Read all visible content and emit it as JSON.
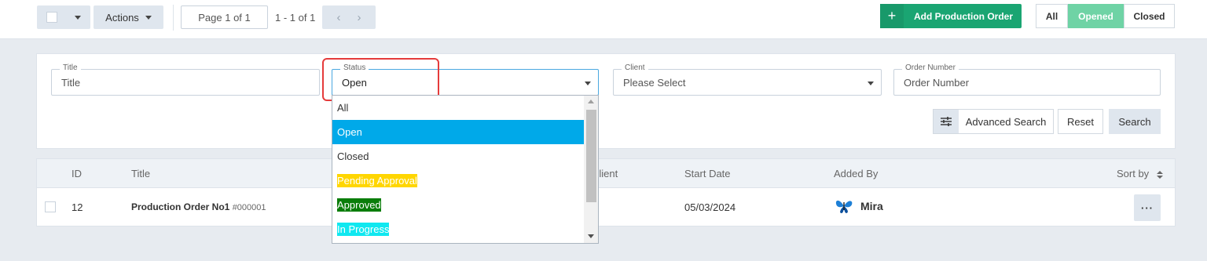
{
  "toolbar": {
    "actions_label": "Actions",
    "page_label": "Page 1 of 1",
    "range_label": "1 - 1 of 1",
    "prev_glyph": "‹",
    "next_glyph": "›",
    "add_plus": "+",
    "add_label": "Add Production Order",
    "filter_all": "All",
    "filter_opened": "Opened",
    "filter_closed": "Closed"
  },
  "filters": {
    "title": {
      "label": "Title",
      "placeholder": "Title"
    },
    "status": {
      "label": "Status",
      "value": "Open"
    },
    "client": {
      "label": "Client",
      "value": "Please Select"
    },
    "order_number": {
      "label": "Order Number",
      "placeholder": "Order Number"
    },
    "advanced_search_label": "Advanced Search",
    "reset_label": "Reset",
    "search_label": "Search"
  },
  "status_options": [
    {
      "label": "All",
      "bg": "",
      "fg": "#333333"
    },
    {
      "label": "Open",
      "bg": "#00a9e9",
      "fg": "#ffffff",
      "selected": true
    },
    {
      "label": "Closed",
      "bg": "",
      "fg": "#333333"
    },
    {
      "label": "Pending Approval",
      "bg": "#ffd600",
      "fg": "#ffffff"
    },
    {
      "label": "Approved",
      "bg": "#0a7d0a",
      "fg": "#ffffff"
    },
    {
      "label": "In Progress",
      "bg": "#10e8f0",
      "fg": "#ffffff"
    }
  ],
  "table": {
    "headers": {
      "id": "ID",
      "title": "Title",
      "client": "Client",
      "start_date": "Start Date",
      "added_by": "Added By",
      "sort_by": "Sort by"
    },
    "rows": [
      {
        "id": "12",
        "title": "Production Order No1",
        "code": "#000001",
        "start_date": "05/03/2024",
        "added_by": "Mira",
        "more": "···"
      }
    ]
  },
  "colors": {
    "accent_green": "#1aa572",
    "opened_green": "#6fd3a5",
    "selection_blue": "#00a9e9",
    "highlight_red": "#e53b3b"
  }
}
